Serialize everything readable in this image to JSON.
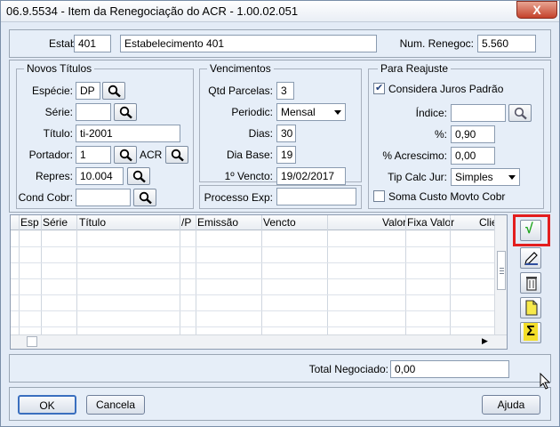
{
  "window": {
    "title": "06.9.5534 - Item da Renegociação do ACR - 1.00.02.051",
    "close_label": "X"
  },
  "header": {
    "estab_label": "Estab:",
    "estab_code": "401",
    "estab_name": "Estabelecimento 401",
    "num_renegoc_label": "Num. Renegoc:",
    "num_renegoc_value": "5.560"
  },
  "novos_titulos": {
    "legend": "Novos Títulos",
    "especie_label": "Espécie:",
    "especie_value": "DP",
    "serie_label": "Série:",
    "serie_value": "",
    "titulo_label": "Título:",
    "titulo_value": "ti-2001",
    "portador_label": "Portador:",
    "portador_value": "1",
    "portador_extra": "ACR",
    "repres_label": "Repres:",
    "repres_value": "10.004",
    "cond_cobr_label": "Cond Cobr:",
    "cond_cobr_value": ""
  },
  "vencimentos": {
    "legend": "Vencimentos",
    "qtd_parcelas_label": "Qtd Parcelas:",
    "qtd_parcelas_value": "3",
    "periodic_label": "Periodic:",
    "periodic_value": "Mensal",
    "dias_label": "Dias:",
    "dias_value": "30",
    "dia_base_label": "Dia Base:",
    "dia_base_value": "19",
    "primeiro_vencto_label": "1º Vencto:",
    "primeiro_vencto_value": "19/02/2017",
    "processo_exp_label": "Processo Exp:",
    "processo_exp_value": ""
  },
  "reajuste": {
    "legend": "Para Reajuste",
    "considera_juros_label": "Considera Juros Padrão",
    "considera_juros_checked": true,
    "indice_label": "Índice:",
    "indice_value": "",
    "percent_label": "%:",
    "percent_value": "0,90",
    "acrescimo_label": "% Acrescimo:",
    "acrescimo_value": "0,00",
    "tip_calc_label": "Tip Calc Jur:",
    "tip_calc_value": "Simples",
    "soma_custo_label": "Soma Custo Movto Cobr",
    "soma_custo_checked": false
  },
  "grid": {
    "columns": [
      "Esp",
      "Série",
      "Título",
      "/P",
      "Emissão",
      "Vencto",
      "Valor",
      "Fixa Valor",
      "Clie"
    ]
  },
  "totals": {
    "total_negociado_label": "Total Negociado:",
    "total_negociado_value": "0,00"
  },
  "footer": {
    "ok_label": "OK",
    "cancel_label": "Cancela",
    "help_label": "Ajuda"
  },
  "side_toolbar": {
    "icons": [
      "confirm-check-icon",
      "edit-pencil-icon",
      "delete-trash-icon",
      "new-document-icon",
      "sum-sigma-icon"
    ]
  },
  "colors": {
    "highlight": "#e31e1e",
    "confirm_check": "#1fa51f"
  }
}
